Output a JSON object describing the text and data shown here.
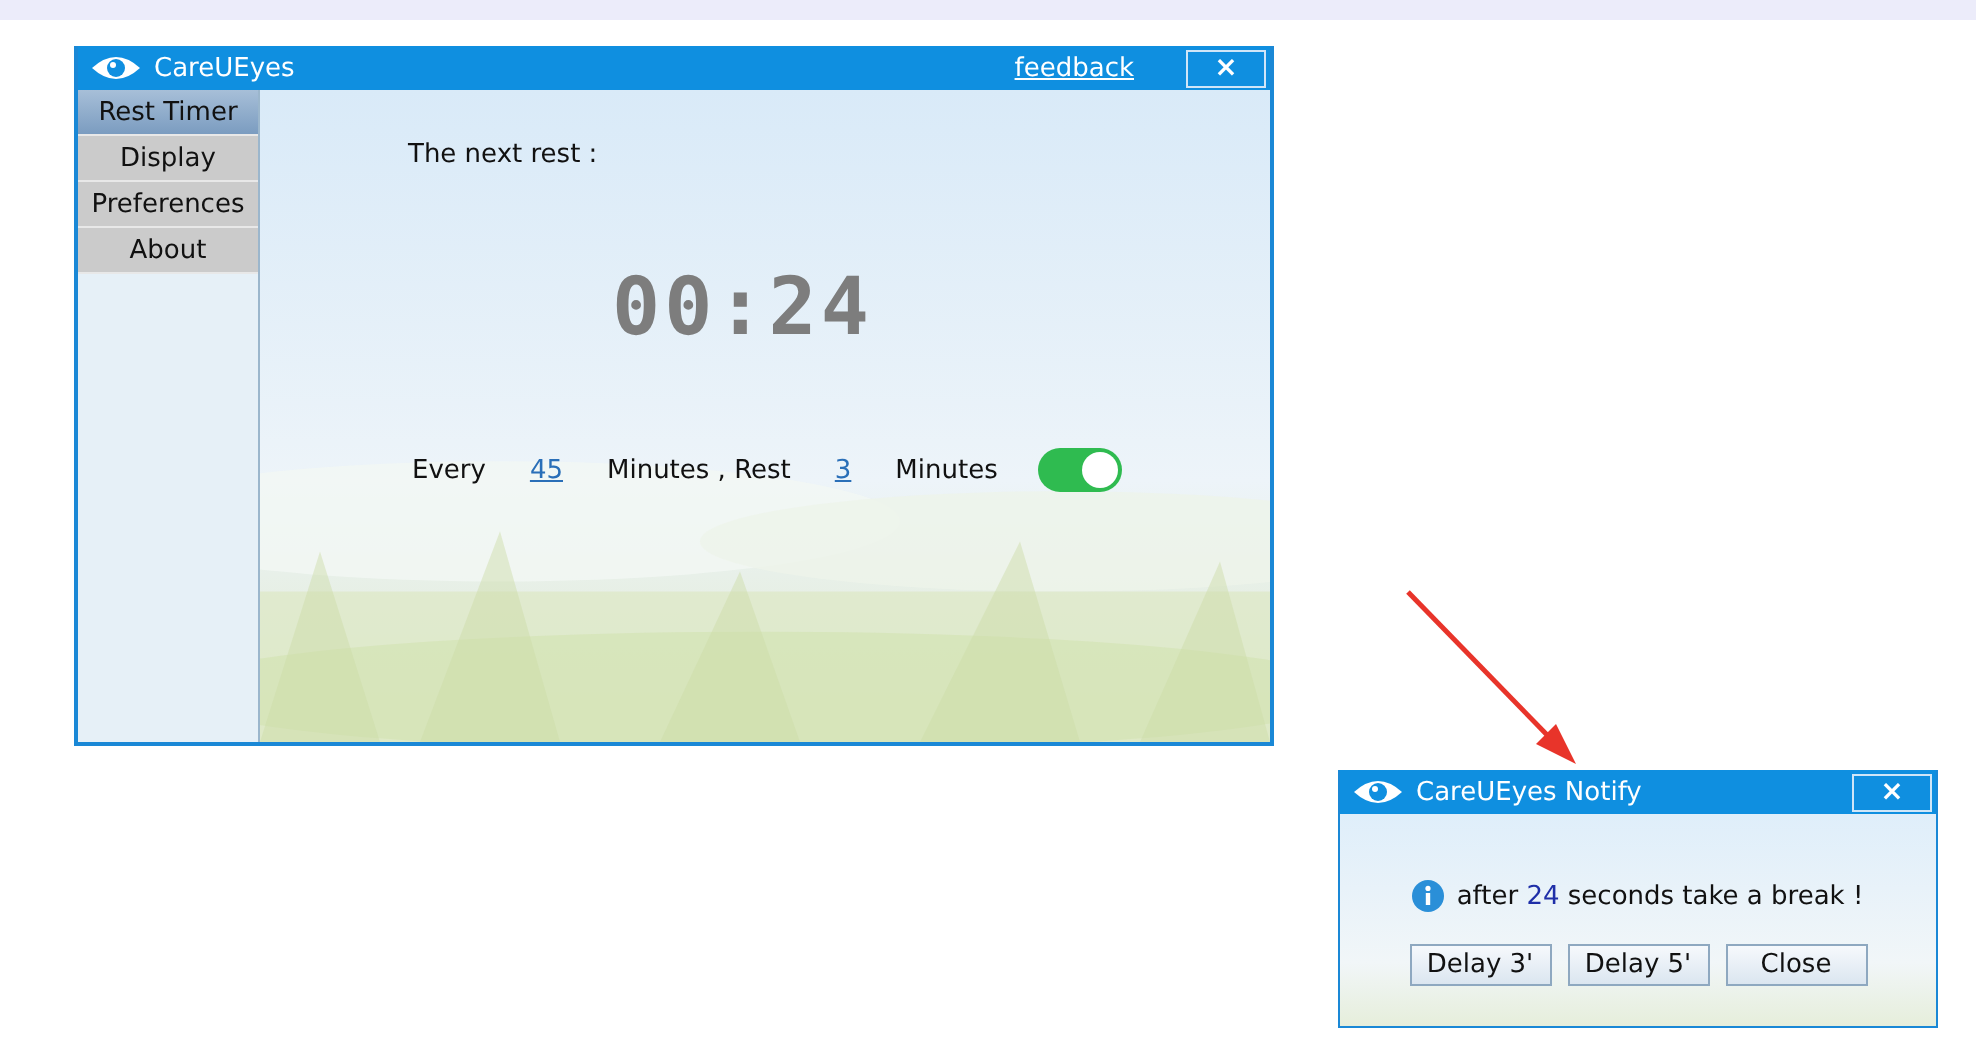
{
  "main_window": {
    "title": "CareUEyes",
    "feedback_link": "feedback",
    "close": "×"
  },
  "sidebar": {
    "items": [
      {
        "label": "Rest Timer",
        "selected": true
      },
      {
        "label": "Display",
        "selected": false
      },
      {
        "label": "Preferences",
        "selected": false
      },
      {
        "label": "About",
        "selected": false
      }
    ]
  },
  "timer": {
    "heading": "The next rest :",
    "countdown": "00:24"
  },
  "schedule": {
    "every_label": "Every",
    "work_minutes": "45",
    "middle_label": "Minutes , Rest",
    "rest_minutes": "3",
    "end_label": "Minutes",
    "enabled": true
  },
  "notify_window": {
    "title": "CareUEyes Notify",
    "close": "×",
    "message": {
      "before": "after",
      "count": "24",
      "after": "seconds take a break !"
    },
    "buttons": [
      "Delay 3'",
      "Delay 5'",
      "Close"
    ]
  }
}
